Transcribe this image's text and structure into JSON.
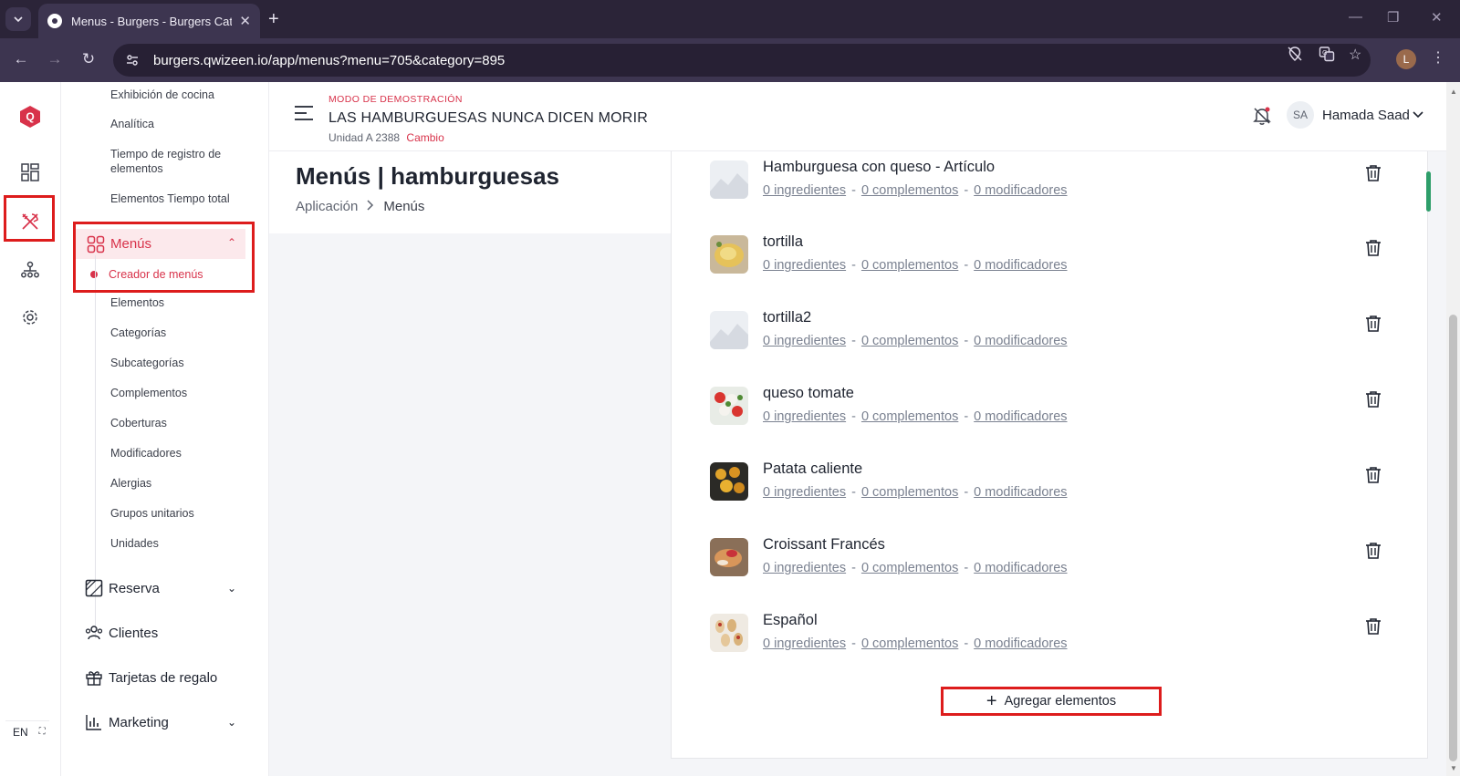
{
  "browser": {
    "tab_title": "Menus - Burgers - Burgers Cate",
    "url": "burgers.qwizeen.io/app/menus?menu=705&category=895",
    "profile_initial": "L"
  },
  "rail": {
    "lang": "EN"
  },
  "sidebar": {
    "sub_items_top": [
      "Exhibición de cocina",
      "Analítica",
      "Tiempo de registro de elementos",
      "Elementos Tiempo total"
    ],
    "menus_label": "Menús",
    "creador_label": "Creador de menús",
    "menus_children": [
      "Elementos",
      "Categorías",
      "Subcategorías",
      "Complementos",
      "Coberturas",
      "Modificadores",
      "Alergias",
      "Grupos unitarios",
      "Unidades"
    ],
    "main_items": [
      "Reserva",
      "Clientes",
      "Tarjetas de regalo",
      "Marketing"
    ]
  },
  "header": {
    "demo_mode": "MODO DE DEMOSTRACIÓN",
    "restaurant_name": "LAS HAMBURGUESAS NUNCA DICEN MORIR",
    "unit_text": "Unidad A 2388",
    "change_label": "Cambio",
    "avatar_initials": "SA",
    "user_name": "Hamada Saad"
  },
  "page": {
    "title": "Menús | hamburguesas",
    "breadcrumb": [
      "Aplicación",
      "Menús"
    ]
  },
  "items": [
    {
      "name": "Hamburguesa con queso - Artículo",
      "ingredients": "0 ingredientes",
      "complements": "0 complementos",
      "modifiers": "0 modificadores",
      "thumb": "placeholder"
    },
    {
      "name": "tortilla",
      "ingredients": "0 ingredientes",
      "complements": "0 complementos",
      "modifiers": "0 modificadores",
      "thumb": "tortilla"
    },
    {
      "name": "tortilla2",
      "ingredients": "0 ingredientes",
      "complements": "0 complementos",
      "modifiers": "0 modificadores",
      "thumb": "placeholder"
    },
    {
      "name": "queso tomate",
      "ingredients": "0 ingredientes",
      "complements": "0 complementos",
      "modifiers": "0 modificadores",
      "thumb": "caprese"
    },
    {
      "name": "Patata caliente",
      "ingredients": "0 ingredientes",
      "complements": "0 complementos",
      "modifiers": "0 modificadores",
      "thumb": "potatoes"
    },
    {
      "name": "Croissant Francés",
      "ingredients": "0 ingredientes",
      "complements": "0 complementos",
      "modifiers": "0 modificadores",
      "thumb": "croissant"
    },
    {
      "name": "Español",
      "ingredients": "0 ingredientes",
      "complements": "0 complementos",
      "modifiers": "0 modificadores",
      "thumb": "spanish"
    }
  ],
  "add_button_label": "Agregar elementos",
  "colors": {
    "brand": "#d8324a",
    "highlight": "#dd1c1c",
    "active_bg": "#fce9ec"
  }
}
